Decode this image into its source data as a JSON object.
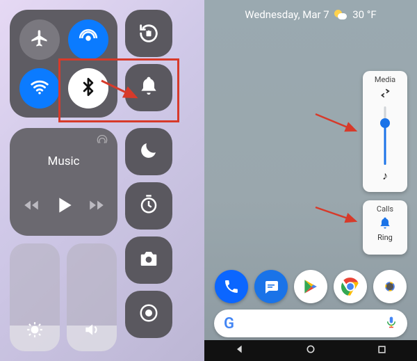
{
  "ios": {
    "music_label": "Music"
  },
  "android": {
    "date": "Wednesday, Mar 7",
    "temp": "30 °F",
    "media": {
      "title": "Media",
      "slider_value": 70
    },
    "calls": {
      "title": "Calls",
      "mode": "Ring"
    },
    "search_placeholder": "",
    "dock": [
      "Phone",
      "Messages",
      "Play Store",
      "Chrome",
      "Camera"
    ]
  },
  "colors": {
    "accent_blue": "#1a73e8",
    "ios_blue": "#0b7bff",
    "highlight_red": "#d73a2a"
  }
}
